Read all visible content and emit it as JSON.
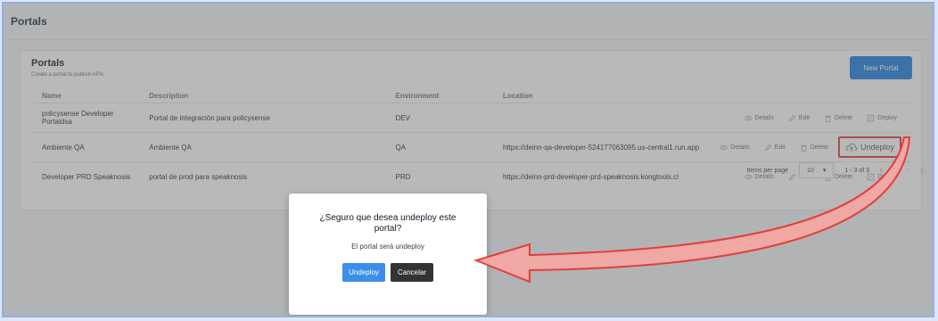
{
  "header": {
    "title": "Portals"
  },
  "card": {
    "title": "Portals",
    "subtitle": "Create a portal to publish APIs",
    "new_button": "New Portal"
  },
  "table": {
    "columns": [
      "Name",
      "Description",
      "Environment",
      "Location"
    ],
    "rows": [
      {
        "name": "policysense Developer Portaldsa",
        "description": "Portal de integración para policysense",
        "environment": "DEV",
        "location": "",
        "last_action": "Deploy"
      },
      {
        "name": "Ambiente QA",
        "description": "Ambiente QA",
        "environment": "QA",
        "location": "https://deinn-qa-developer-524177063095.us-central1.run.app",
        "last_action": "Undeploy"
      },
      {
        "name": "Developer PRD Speaknosis",
        "description": "portal de prod para speaknosis",
        "environment": "PRD",
        "location": "https://deinn-prd-developer-prd-speaknosis.kongtools.cl",
        "last_action": "Deploy"
      }
    ],
    "actions": {
      "details": "Details",
      "edit": "Edit",
      "delete": "Delete"
    }
  },
  "pager": {
    "items_per_page_label": "Items per page",
    "items_per_page": "10",
    "range": "1 - 3 of 3"
  },
  "modal": {
    "title": "¿Seguro que desea undeploy este portal?",
    "message": "El portal será undeploy",
    "confirm": "Undeploy",
    "cancel": "Cancelar"
  },
  "colors": {
    "primary": "#1d7fe0",
    "highlight": "#e53935",
    "arrow_fill": "#f4a8a4"
  }
}
